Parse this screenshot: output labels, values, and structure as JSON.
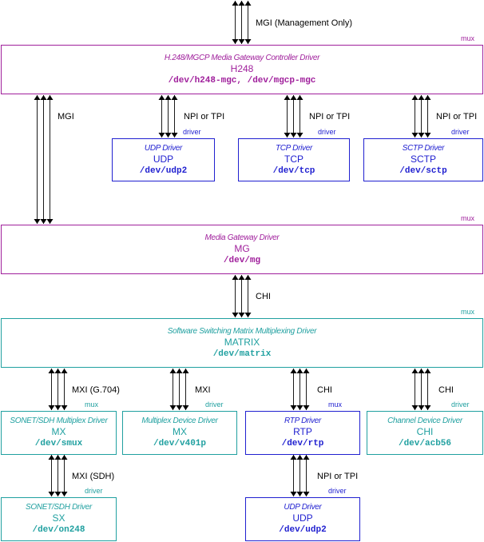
{
  "colors": {
    "mux_purple": "#a0209c",
    "blue": "#2020d0",
    "teal": "#20a0a0"
  },
  "boxes": {
    "h248": {
      "title": "H.248/MGCP Media Gateway Controller Driver",
      "name": "H248",
      "device": "/dev/h248-mgc, /dev/mgcp-mgc",
      "tag": "mux",
      "color": "mux_purple"
    },
    "udp_top": {
      "title": "UDP Driver",
      "name": "UDP",
      "device": "/dev/udp2",
      "tag": "driver",
      "color": "blue"
    },
    "tcp": {
      "title": "TCP Driver",
      "name": "TCP",
      "device": "/dev/tcp",
      "tag": "driver",
      "color": "blue"
    },
    "sctp": {
      "title": "SCTP Driver",
      "name": "SCTP",
      "device": "/dev/sctp",
      "tag": "driver",
      "color": "blue"
    },
    "mg": {
      "title": "Media Gateway Driver",
      "name": "MG",
      "device": "/dev/mg",
      "tag": "mux",
      "color": "mux_purple"
    },
    "matrix": {
      "title": "Software Switching Matrix Multiplexing Driver",
      "name": "MATRIX",
      "device": "/dev/matrix",
      "tag": "mux",
      "color": "blue"
    },
    "smux": {
      "title": "SONET/SDH Multiplex Driver",
      "name": "MX",
      "device": "/dev/smux",
      "tag": "mux",
      "color": "teal"
    },
    "v401p": {
      "title": "Multiplex Device Driver",
      "name": "MX",
      "device": "/dev/v401p",
      "tag": "driver",
      "color": "teal"
    },
    "rtp": {
      "title": "RTP Driver",
      "name": "RTP",
      "device": "/dev/rtp",
      "tag": "mux",
      "color": "blue"
    },
    "acb56": {
      "title": "Channel Device Driver",
      "name": "CHI",
      "device": "/dev/acb56",
      "tag": "driver",
      "color": "teal"
    },
    "on248": {
      "title": "SONET/SDH Driver",
      "name": "SX",
      "device": "/dev/on248",
      "tag": "driver",
      "color": "teal"
    },
    "udp_bottom": {
      "title": "UDP Driver",
      "name": "UDP",
      "device": "/dev/udp2",
      "tag": "driver",
      "color": "blue"
    }
  },
  "interfaces": {
    "top": "MGI (Management Only)",
    "h248_mg": "MGI",
    "h248_udp": "NPI or TPI",
    "h248_tcp": "NPI or TPI",
    "h248_sctp": "NPI or TPI",
    "mg_matrix": "CHI",
    "matrix_smux": "MXI (G.704)",
    "matrix_v401p": "MXI",
    "matrix_rtp": "CHI",
    "matrix_acb56": "CHI",
    "smux_on248": "MXI (SDH)",
    "rtp_udp": "NPI or TPI"
  }
}
